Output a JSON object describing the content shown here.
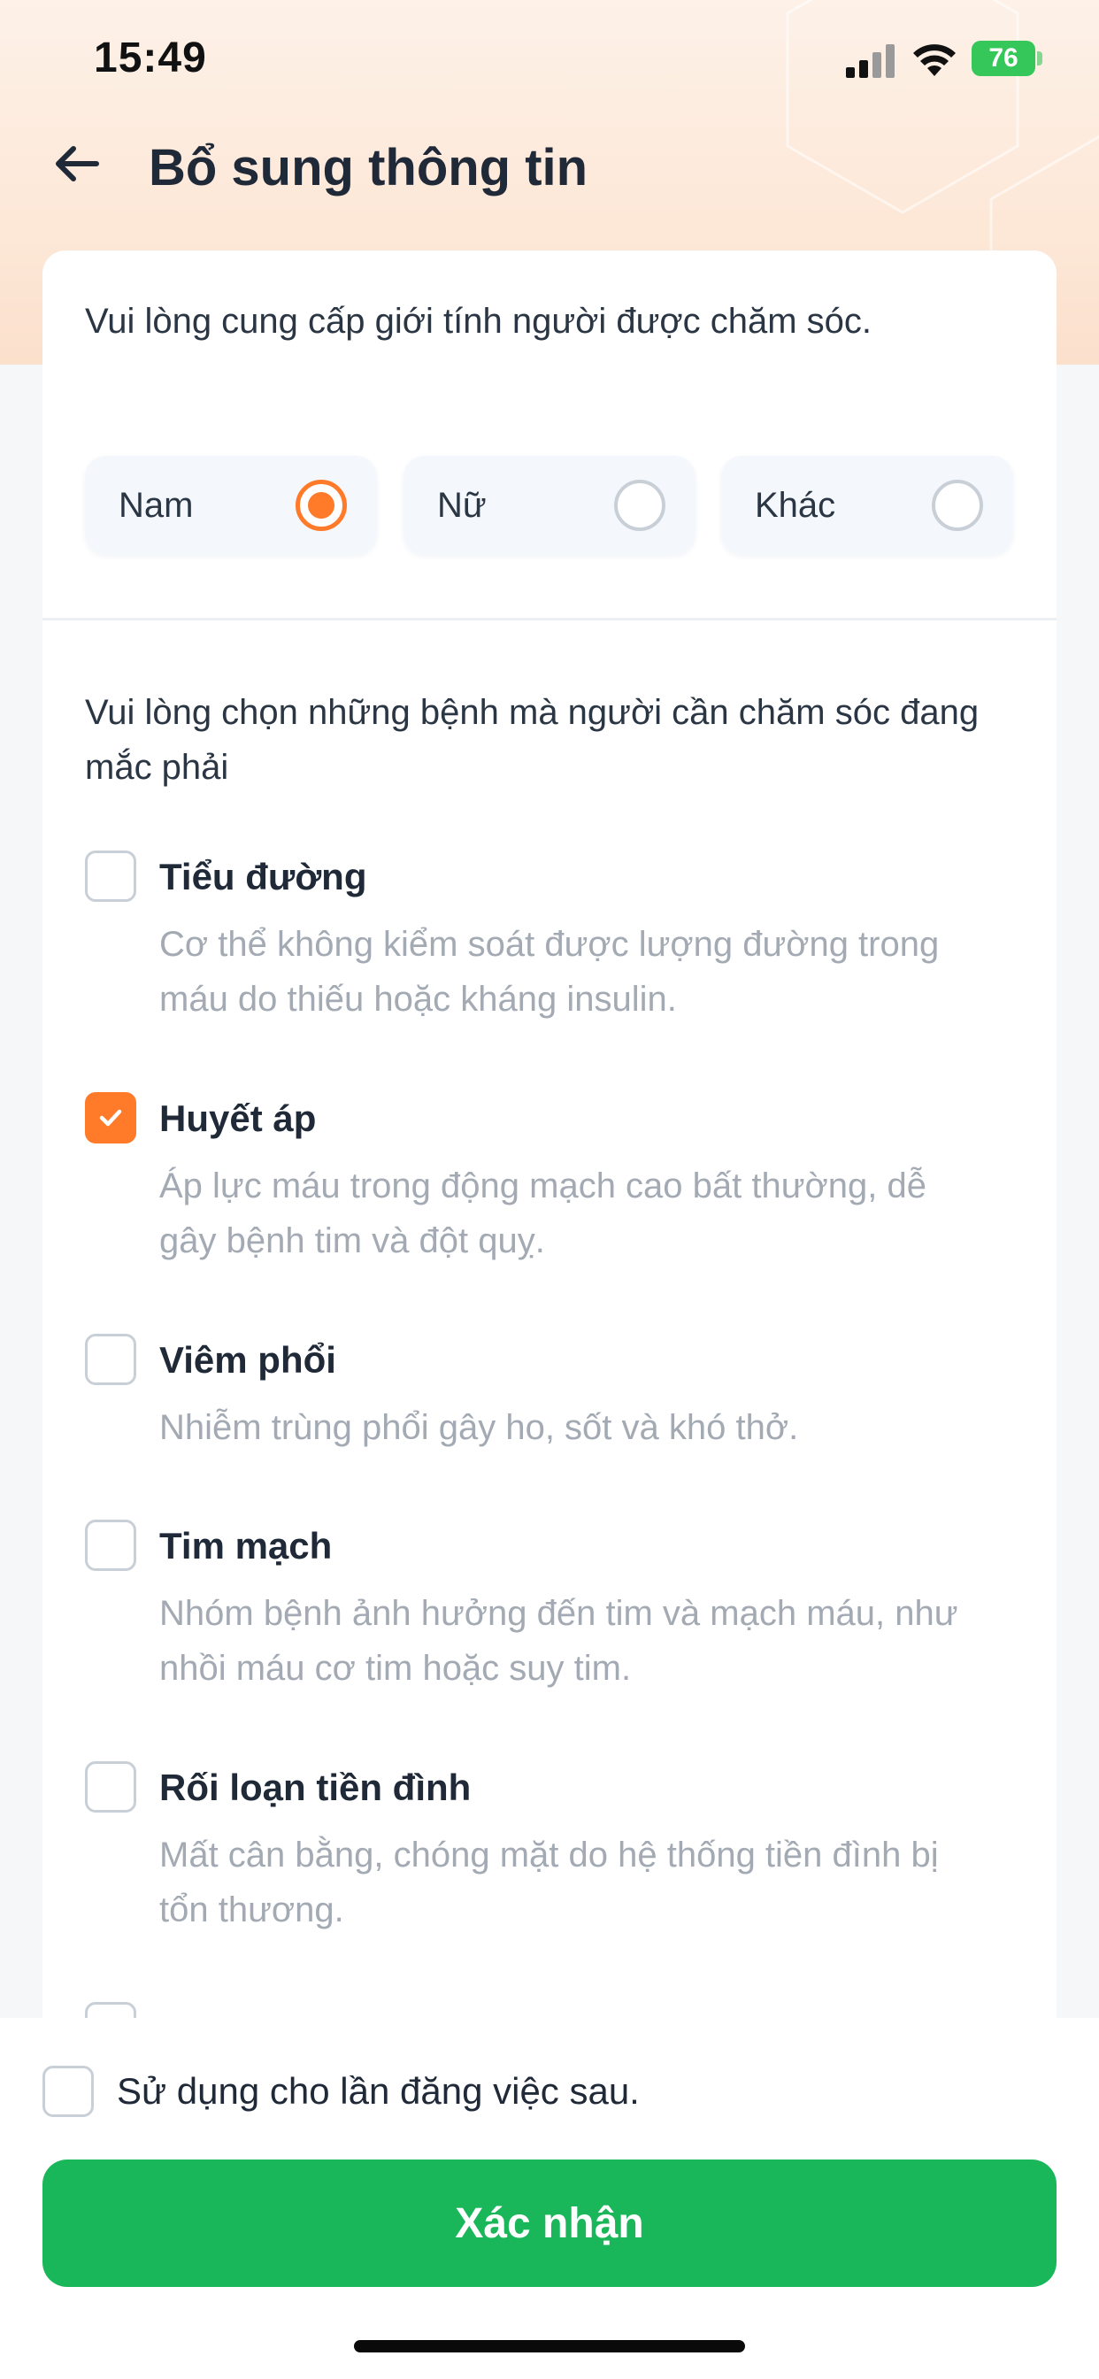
{
  "status_bar": {
    "time": "15:49",
    "battery": "76"
  },
  "header": {
    "title": "Bổ sung thông tin",
    "back_icon": "arrow-left-icon"
  },
  "gender": {
    "prompt": "Vui lòng cung cấp giới tính người được chăm sóc.",
    "options": [
      {
        "label": "Nam",
        "selected": true
      },
      {
        "label": "Nữ",
        "selected": false
      },
      {
        "label": "Khác",
        "selected": false
      }
    ]
  },
  "diseases": {
    "prompt": "Vui lòng chọn những bệnh mà người cần chăm sóc đang mắc phải",
    "items": [
      {
        "title": "Tiểu đường",
        "desc": "Cơ thể không kiểm soát được lượng đường trong máu do thiếu hoặc kháng insulin.",
        "checked": false
      },
      {
        "title": "Huyết áp",
        "desc": "Áp lực máu trong động mạch cao bất thường, dễ gây bệnh tim và đột quỵ.",
        "checked": true
      },
      {
        "title": "Viêm phổi",
        "desc": "Nhiễm trùng phổi gây ho, sốt và khó thở.",
        "checked": false
      },
      {
        "title": "Tim mạch",
        "desc": "Nhóm bệnh ảnh hưởng đến tim và mạch máu, như nhồi máu cơ tim hoặc suy tim.",
        "checked": false
      },
      {
        "title": "Rối loạn tiền đình",
        "desc": "Mất cân bằng, chóng mặt do hệ thống tiền đình bị tổn thương.",
        "checked": false
      }
    ]
  },
  "footer": {
    "save_label": "Sử dụng cho lần đăng việc sau.",
    "save_checked": false,
    "confirm_label": "Xác nhận"
  },
  "colors": {
    "accent": "#ff7a29",
    "primary": "#1ab75a"
  }
}
